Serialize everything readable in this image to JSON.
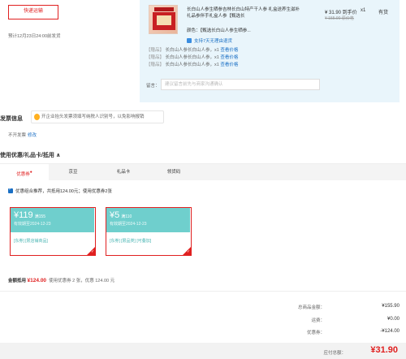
{
  "shipping": {
    "button_label": "快递运输",
    "est_date": "预计12月23日24:00前发货"
  },
  "product": {
    "title": "长白山人参生晒参吉林长白山特产干人参 礼盒送养生滋补礼品参伴手礼盒人参【甄选长",
    "color_label": "颜色：【甄选长白山人参生晒参...",
    "price": "¥ 31.90 到手价",
    "old_price": "¥ 155.90 原价格",
    "qty": "x1",
    "stock": "有货",
    "return_note": "支持7天无理由退货",
    "gifts": [
      {
        "tag": "【赠品】",
        "text": "长白山人参长白山人参，x1",
        "link": "查看价格"
      },
      {
        "tag": "【赠品】",
        "text": "长白山人参长白山人参，x1",
        "link": "查看价格"
      },
      {
        "tag": "【赠品】",
        "text": "长白山人参长白山人参，x1",
        "link": "查看价格"
      }
    ],
    "remark_label": "留言：",
    "remark_placeholder": "建议留言前先与商家沟通确认"
  },
  "invoice": {
    "title": "发票信息",
    "tip": "开企业抬头发票须填写纳税人识别号，以免影响报销",
    "status": "不开发票",
    "edit": "修改"
  },
  "coupons": {
    "title": "使用优惠/礼品卡/抵用 ∧",
    "tabs": [
      {
        "label": "优惠券",
        "mark": "●"
      },
      {
        "label": "京豆",
        "mark": ""
      },
      {
        "label": "礼品卡",
        "mark": ""
      },
      {
        "label": "领货码",
        "mark": ""
      }
    ],
    "combo": "优惠组合推荐，共抵用124.00元；使用优惠券2张",
    "items": [
      {
        "amount": "¥119",
        "cond": "满155",
        "valid": "有效期至2024-12-23",
        "tags": "[东券]  [限店铺商品]"
      },
      {
        "amount": "¥5",
        "cond": "满110",
        "valid": "有效期至2024-12-23",
        "tags": "[东券]  [限品类]  [可叠加]"
      }
    ]
  },
  "discount_summary": {
    "label": "金额抵用",
    "amount": "¥124.00",
    "detail": "使用优惠券 2 张，优惠 124.00 元"
  },
  "summary": {
    "rows": [
      {
        "label": "总商品金额：",
        "value": "¥155.90"
      },
      {
        "label": "运费：",
        "value": "¥0.00"
      },
      {
        "label": "优惠券：",
        "value": "-¥124.00"
      }
    ],
    "total_label": "应付总额：",
    "total_value": "¥31.90"
  }
}
